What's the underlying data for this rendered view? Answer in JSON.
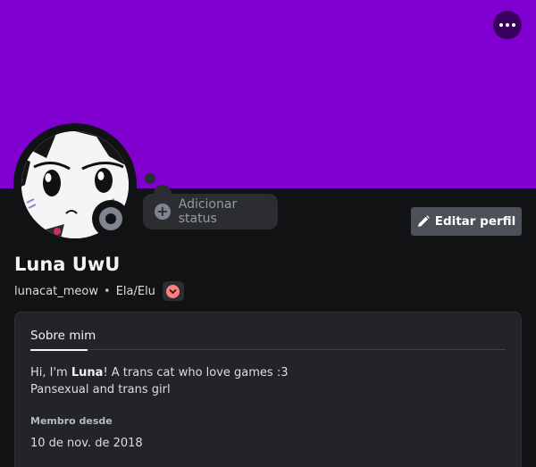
{
  "profile": {
    "banner_color": "#8000d0",
    "display_name": "Luna UwU",
    "username": "lunacat_meow",
    "separator": "•",
    "pronouns": "Ela/Elu",
    "status_icon": "idle-offline-status-icon",
    "badge_icon": "chevron-badge-icon"
  },
  "actions": {
    "more_icon": "more-dots-icon",
    "add_status_label": "Adicionar status",
    "edit_profile_label": "Editar perfil"
  },
  "about": {
    "tab_label": "Sobre mim",
    "bio_prefix": "Hi, I'm ",
    "bio_name": "Luna",
    "bio_suffix": "! A trans cat who love games :3",
    "bio_line2": "Pansexual and trans girl",
    "member_since_label": "Membro desde",
    "member_since_value": "10 de nov. de 2018"
  }
}
